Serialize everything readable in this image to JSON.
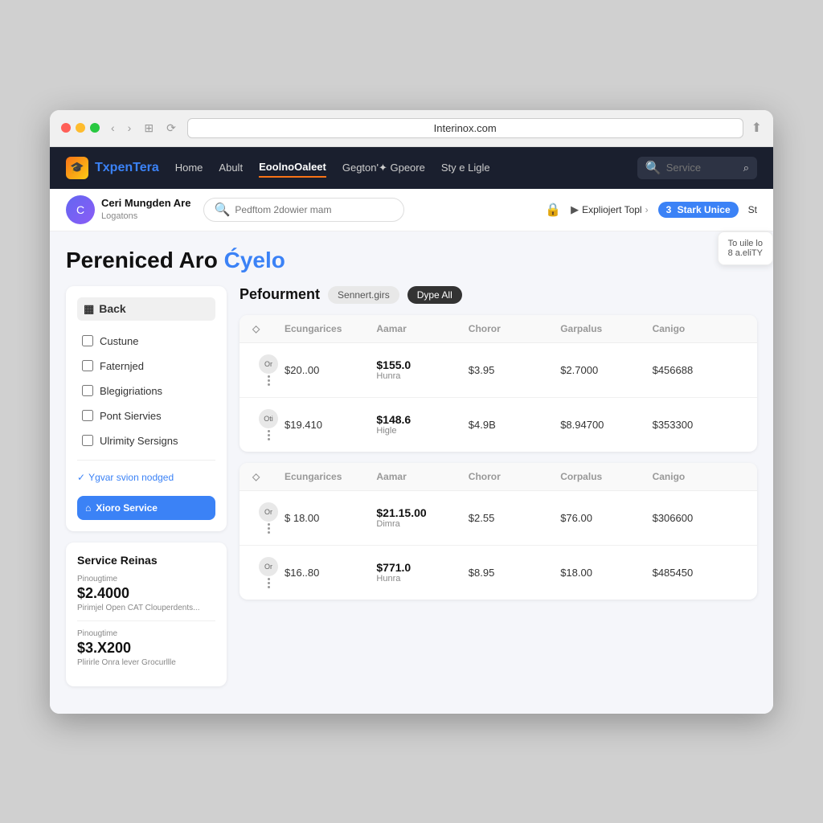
{
  "browser": {
    "url": "Interinox.com"
  },
  "nav": {
    "logo_text_1": "TxpenT",
    "logo_text_2": "era",
    "links": [
      {
        "label": "Home",
        "active": false
      },
      {
        "label": "Abult",
        "active": false
      },
      {
        "label": "EoolnoOaleet",
        "active": true
      },
      {
        "label": "Gegton'✦ Gpeore",
        "active": false
      },
      {
        "label": "Sty e Ligle",
        "active": false
      }
    ],
    "search_placeholder": "Service"
  },
  "sub_nav": {
    "user_name": "Ceri Mungden Are",
    "user_sub": "Logatons",
    "search_placeholder": "Pedftom 2dowier mam",
    "explore_label": "Expliojert Topl",
    "stark_label": "Stark Unice",
    "st_label": "St"
  },
  "page_title_1": "Pereniced Aro ",
  "page_title_2": "Ćyelo",
  "tooltip": {
    "line1": "To uile lo",
    "line2": "8 a.eliTY"
  },
  "section": {
    "title": "Pefourment",
    "pill1": "Sennert.girs",
    "pill2": "Dype All"
  },
  "table1": {
    "headers": [
      "",
      "Ecungarices",
      "Aamar",
      "Choror",
      "Garpalus",
      "Canigo"
    ],
    "rows": [
      {
        "icon": "Or",
        "ecungarices": "$20..00",
        "aamar_bold": "$155.0",
        "aamar_sub": "Hunra",
        "choror": "$3.95",
        "garpalus": "$2.7000",
        "canigo": "$456688"
      },
      {
        "icon": "Oti",
        "ecungarices": "$19.410",
        "aamar_bold": "$148.6",
        "aamar_sub": "Higle",
        "choror": "$4.9B",
        "garpalus": "$8.94700",
        "canigo": "$353300"
      }
    ]
  },
  "table2": {
    "headers": [
      "",
      "Ecungarices",
      "Aamar",
      "Choror",
      "Corpalus",
      "Canigo"
    ],
    "rows": [
      {
        "icon": "Or",
        "ecungarices": "$ 18.00",
        "aamar_bold": "$21.15.00",
        "aamar_sub": "Dimra",
        "choror": "$2.55",
        "garpalus": "$76.00",
        "canigo": "$306600"
      },
      {
        "icon": "Or",
        "ecungarices": "$16..80",
        "aamar_bold": "$771.0",
        "aamar_sub": "Hunra",
        "choror": "$8.95",
        "garpalus": "$18.00",
        "canigo": "$485450"
      }
    ]
  },
  "sidebar": {
    "back_label": "Back",
    "filters": [
      {
        "label": "Custune"
      },
      {
        "label": "Faternjed"
      },
      {
        "label": "Blegigriations"
      },
      {
        "label": "Pont Siervies"
      },
      {
        "label": "Ulrimity Sersigns"
      }
    ],
    "session_label": "Ygvar svion nodged",
    "xoro_service_label": "Xioro Service"
  },
  "service_ratings": {
    "title": "Service Reinas",
    "items": [
      {
        "label": "Pinougtime",
        "price": "$2.4000",
        "desc": "Pirimjel Open CAT Clouperdents..."
      },
      {
        "label": "Pinougtime",
        "price": "$3.X200",
        "desc": "Plirirle Onra lever Grocurllle"
      }
    ]
  }
}
